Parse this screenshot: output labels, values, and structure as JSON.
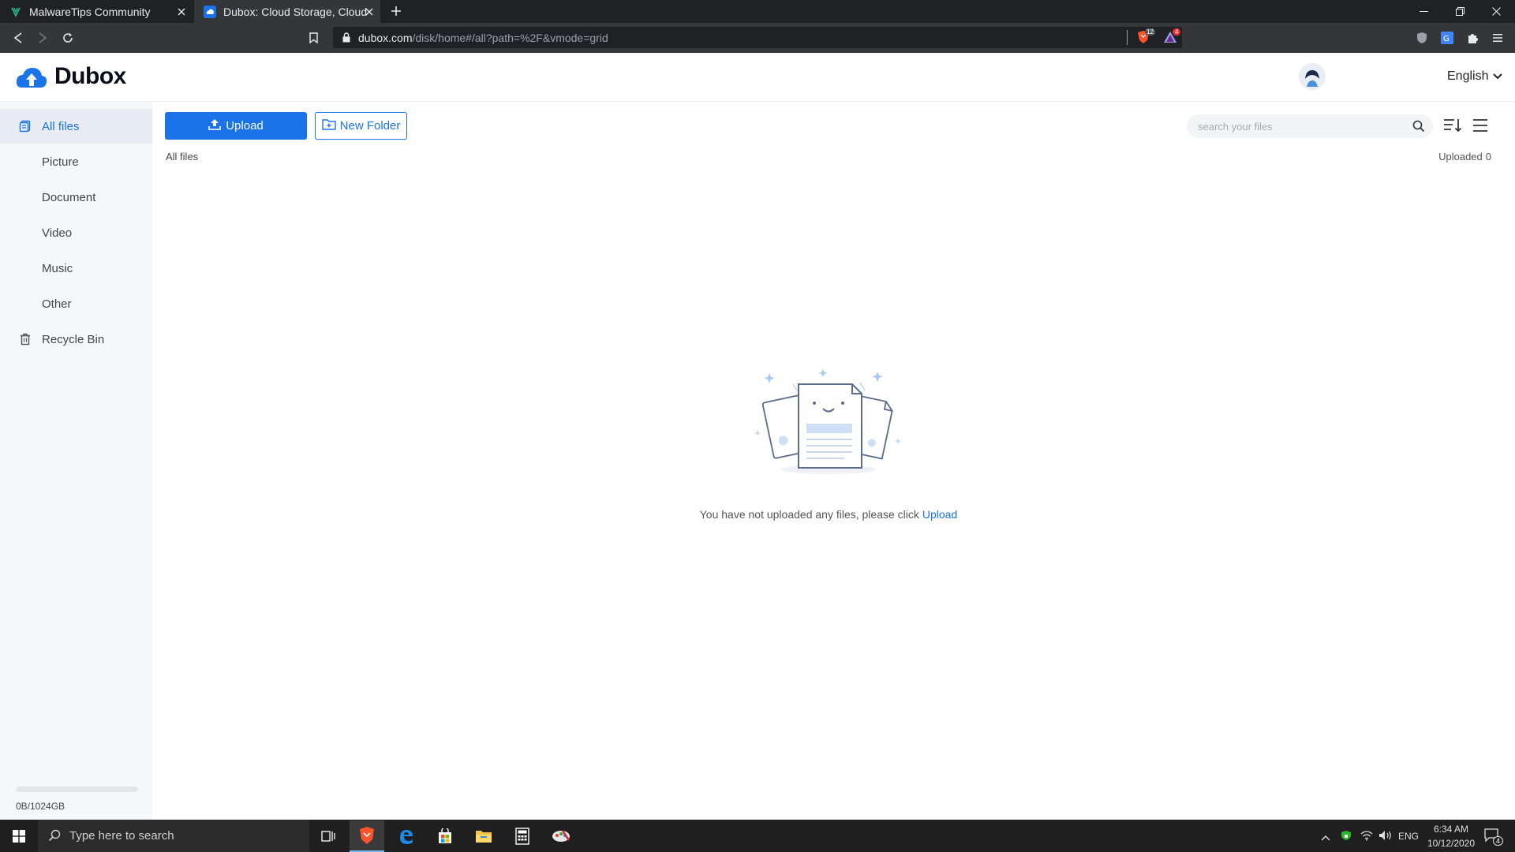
{
  "browser": {
    "tabs": [
      {
        "title": "MalwareTips Community"
      },
      {
        "title": "Dubox: Cloud Storage, Cloud Backup"
      }
    ],
    "url_host": "dubox.com",
    "url_path": "/disk/home#/all?path=%2F&vmode=grid",
    "badges": {
      "brave": "12",
      "rewards": "4"
    }
  },
  "app": {
    "brand": "Dubox",
    "language": "English"
  },
  "sidebar": {
    "items": [
      {
        "label": "All files"
      },
      {
        "label": "Picture"
      },
      {
        "label": "Document"
      },
      {
        "label": "Video"
      },
      {
        "label": "Music"
      },
      {
        "label": "Other"
      },
      {
        "label": "Recycle Bin"
      }
    ],
    "quota": "0B/1024GB",
    "quota_used_fraction": 0
  },
  "main": {
    "upload_label": "Upload",
    "new_folder_label": "New Folder",
    "search_placeholder": "search your files",
    "breadcrumb": "All files",
    "uploaded_label": "Uploaded",
    "uploaded_count": "0",
    "empty_message": "You have not uploaded any files, please click",
    "empty_link": "Upload"
  },
  "taskbar": {
    "search_placeholder": "Type here to search",
    "language": "ENG",
    "time": "6:34 AM",
    "date": "10/12/2020",
    "notifications": "4"
  },
  "colors": {
    "accent": "#1a73e8",
    "sidebar_bg": "#f6f7f9",
    "chrome_dark": "#202124"
  }
}
